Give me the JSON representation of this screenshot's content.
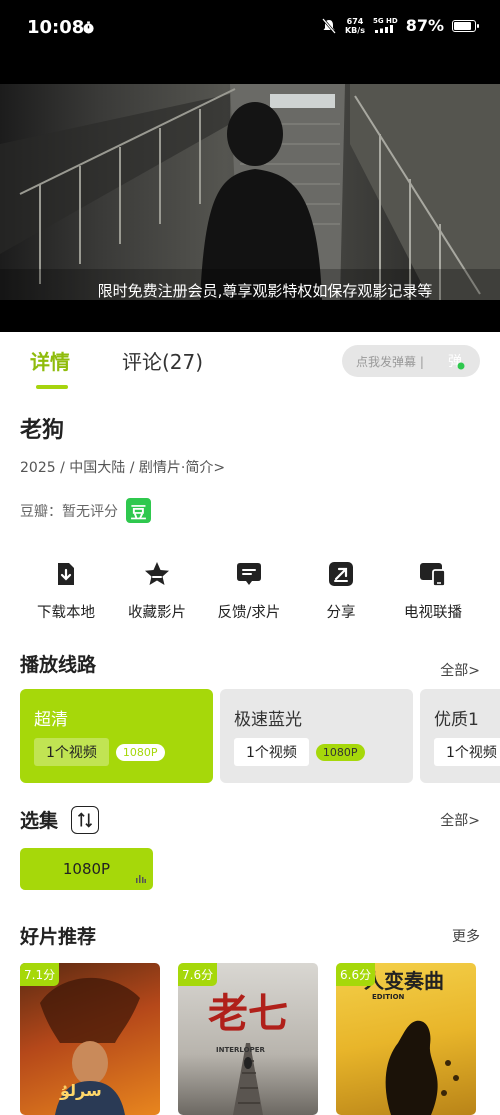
{
  "status": {
    "time": "10:08",
    "speed_value": "674",
    "speed_unit": "KB/s",
    "net_label": "5G HD",
    "battery": "87%",
    "battery_level": 0.87
  },
  "video": {
    "subtitle": "限时免费注册会员,尊享观影特权如保存观影记录等"
  },
  "tabs": {
    "detail": "详情",
    "comments": "评论(27)",
    "danmaku_placeholder": "点我发弹幕 |",
    "danmaku_icon_text": "弹"
  },
  "movie": {
    "title": "老狗",
    "meta": "2025 / 中国大陆 / 剧情片·简介>",
    "rating_label": "豆瓣：暂无评分",
    "douban_badge": "豆"
  },
  "actions": [
    {
      "label": "下载本地",
      "icon": "download-icon"
    },
    {
      "label": "收藏影片",
      "icon": "star-icon"
    },
    {
      "label": "反馈/求片",
      "icon": "feedback-icon"
    },
    {
      "label": "分享",
      "icon": "share-icon"
    },
    {
      "label": "电视联播",
      "icon": "tv-cast-icon"
    }
  ],
  "routes_section": {
    "title": "播放线路",
    "more": "全部>",
    "routes": [
      {
        "name": "超清",
        "count": "1个视频",
        "quality": "1080P",
        "active": true
      },
      {
        "name": "极速蓝光",
        "count": "1个视频",
        "quality": "1080P",
        "active": false
      },
      {
        "name": "优质1",
        "count": "1个视频",
        "quality": "",
        "active": false
      }
    ]
  },
  "episodes_section": {
    "title": "选集",
    "more": "全部>",
    "episodes": [
      "1080P"
    ]
  },
  "recommend_section": {
    "title": "好片推荐",
    "more": "更多",
    "items": [
      {
        "score": "7.1分",
        "poster_text": "سرلۇ"
      },
      {
        "score": "7.6分",
        "poster_text": "老七",
        "poster_sub": "INTERLOPER"
      },
      {
        "score": "6.6分",
        "poster_text": "人变奏曲",
        "poster_sub": "EDITION"
      }
    ]
  },
  "colors": {
    "accent": "#a6d80a",
    "accent_text": "#8fbc0c",
    "douban_green": "#2fc84e"
  }
}
